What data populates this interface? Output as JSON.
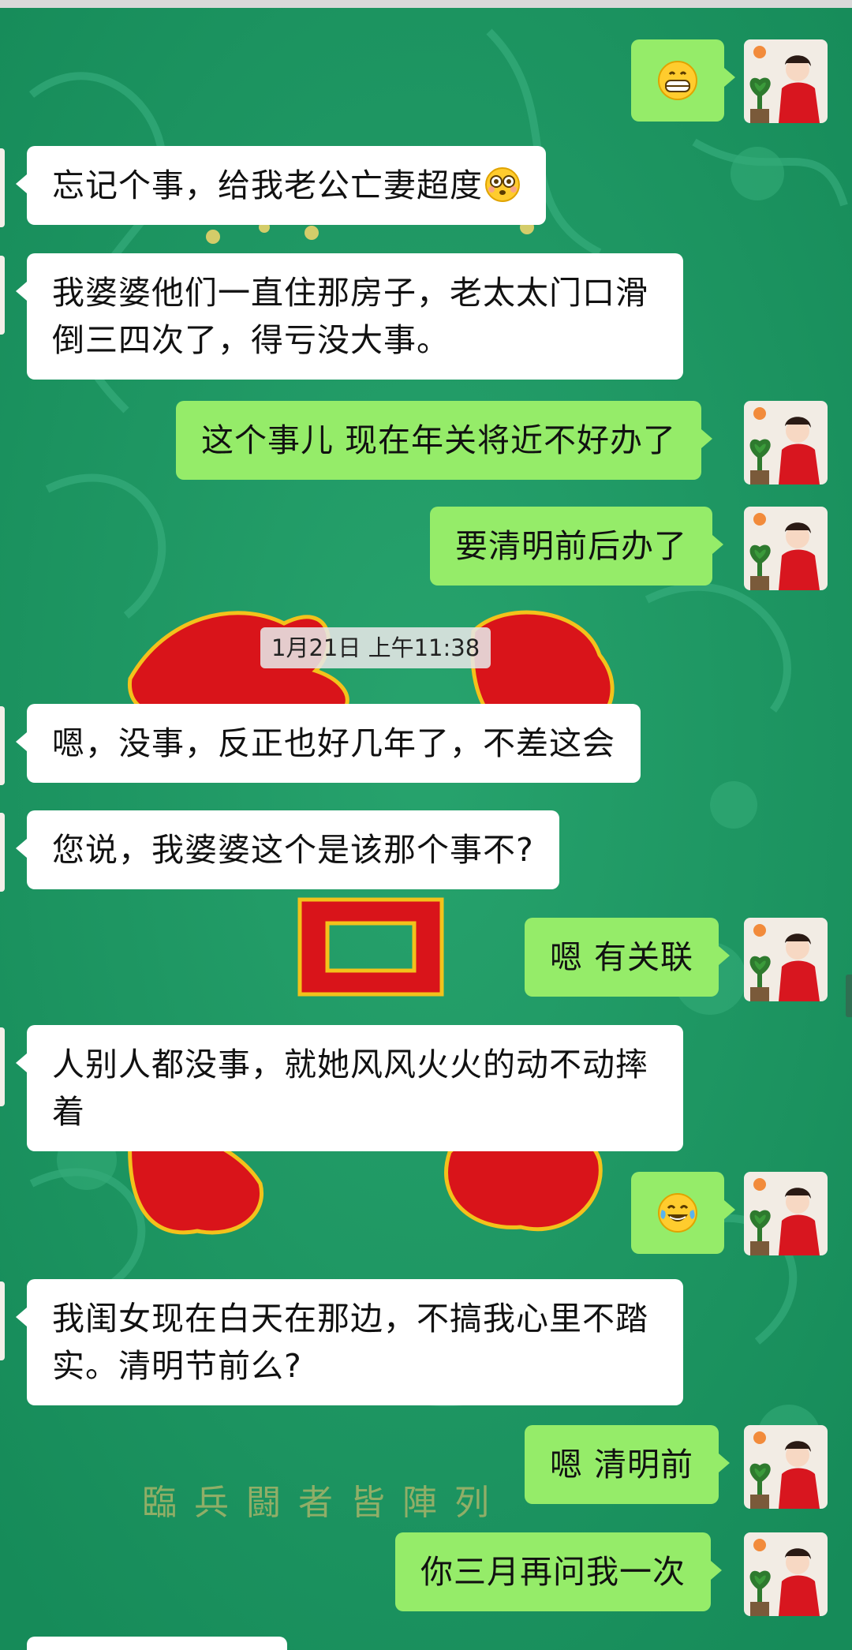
{
  "colors": {
    "chat_background": "#1e9863",
    "incoming_bubble": "#ffffff",
    "outgoing_bubble": "#95ec69",
    "poster_red": "#d9141a"
  },
  "background_poster": {
    "seal_text": "臨兵闘者皆陣列"
  },
  "timestamp": "1月21日 上午11:38",
  "messages": [
    {
      "side": "out",
      "type": "emoji",
      "emoji_icon": "grinning-face-icon"
    },
    {
      "side": "in",
      "text": "忘记个事，给我老公亡妻超度",
      "trailing_emoji": "flushed-face-icon"
    },
    {
      "side": "in",
      "text": "我婆婆他们一直住那房子，老太太门口滑倒三四次了，得亏没大事。"
    },
    {
      "side": "out",
      "text": "这个事儿 现在年关将近不好办了"
    },
    {
      "side": "out",
      "text": "要清明前后办了"
    },
    {
      "side": "in",
      "text": "嗯，没事，反正也好几年了，不差这会"
    },
    {
      "side": "in",
      "text": "您说，我婆婆这个是该那个事不?"
    },
    {
      "side": "out",
      "text": "嗯 有关联"
    },
    {
      "side": "in",
      "text": "人别人都没事，就她风风火火的动不动摔着"
    },
    {
      "side": "out",
      "type": "emoji",
      "emoji_icon": "tears-of-joy-face-icon"
    },
    {
      "side": "in",
      "text": "我闺女现在白天在那边，不搞我心里不踏实。清明节前么?"
    },
    {
      "side": "out",
      "text": "嗯 清明前"
    },
    {
      "side": "out",
      "text": "你三月再问我一次"
    }
  ]
}
